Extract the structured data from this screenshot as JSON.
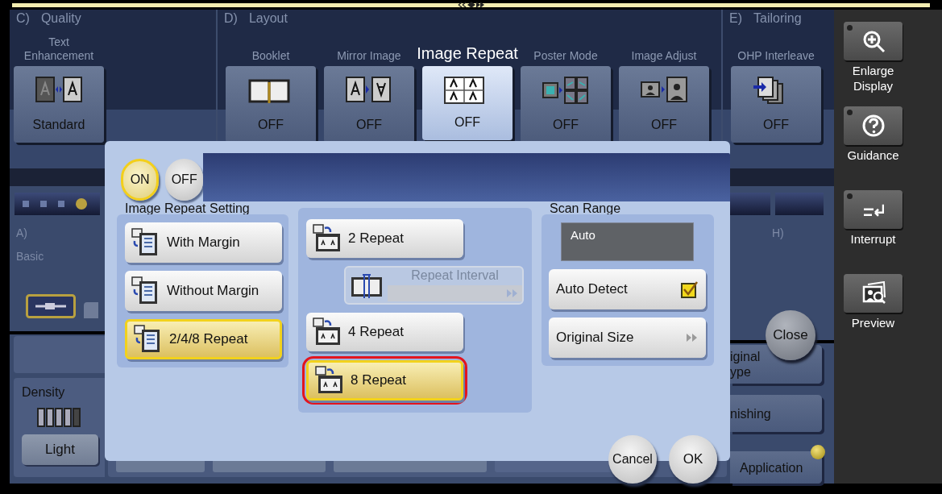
{
  "sections": [
    {
      "letter": "C)",
      "title": "Quality",
      "functions": [
        {
          "label": "Text Enhancement",
          "value": "Standard",
          "kind": "text-enhancement",
          "selected": false
        }
      ]
    },
    {
      "letter": "D)",
      "title": "Layout",
      "functions": [
        {
          "label": "Booklet",
          "value": "OFF",
          "kind": "booklet",
          "selected": false
        },
        {
          "label": "Mirror Image",
          "value": "OFF",
          "kind": "mirror",
          "selected": false
        },
        {
          "label": "Image Repeat",
          "value": "OFF",
          "kind": "repeat",
          "selected": true
        },
        {
          "label": "Poster Mode",
          "value": "OFF",
          "kind": "poster",
          "selected": false
        },
        {
          "label": "Image Adjust",
          "value": "OFF",
          "kind": "adjust",
          "selected": false
        }
      ]
    },
    {
      "letter": "E)",
      "title": "Tailoring",
      "functions": [
        {
          "label": "OHP Interleave",
          "value": "OFF",
          "kind": "ohp",
          "selected": false
        }
      ]
    }
  ],
  "background": {
    "row_letter": "A)",
    "row_title": "Basic",
    "right_letter": "H)",
    "density": "Density",
    "light": "Light",
    "right_buttons": [
      {
        "label": "iginal ype",
        "indicator": false
      },
      {
        "label": "nishing",
        "indicator": false
      },
      {
        "label": "Application",
        "indicator": true
      }
    ],
    "close": "Close"
  },
  "dialog": {
    "toggle": [
      {
        "label": "ON",
        "selected": true
      },
      {
        "label": "OFF",
        "selected": false
      }
    ],
    "setting_title": "Image Repeat Setting",
    "settings": [
      {
        "label": "With Margin",
        "selected": false
      },
      {
        "label": "Without Margin",
        "selected": false
      },
      {
        "label": "2/4/8 Repeat",
        "selected": true
      }
    ],
    "repeats": [
      {
        "kind": "button",
        "label": "2 Repeat",
        "selected": false,
        "highlighted": false
      },
      {
        "kind": "interval",
        "label": "Repeat Interval",
        "disabled": true
      },
      {
        "kind": "button",
        "label": "4 Repeat",
        "selected": false,
        "highlighted": false
      },
      {
        "kind": "button",
        "label": "8 Repeat",
        "selected": true,
        "highlighted": true
      }
    ],
    "scan_range": {
      "title": "Scan Range",
      "value": "Auto",
      "options": [
        {
          "kind": "check",
          "label": "Auto Detect",
          "checked": true
        },
        {
          "kind": "more",
          "label": "Original Size"
        }
      ]
    },
    "cancel": "Cancel",
    "ok": "OK"
  },
  "sidebar": [
    {
      "label": "Enlarge Display",
      "kind": "zoom"
    },
    {
      "label": "Guidance",
      "kind": "help"
    },
    {
      "label": "Interrupt",
      "kind": "interrupt"
    },
    {
      "label": "Preview",
      "kind": "preview"
    }
  ]
}
